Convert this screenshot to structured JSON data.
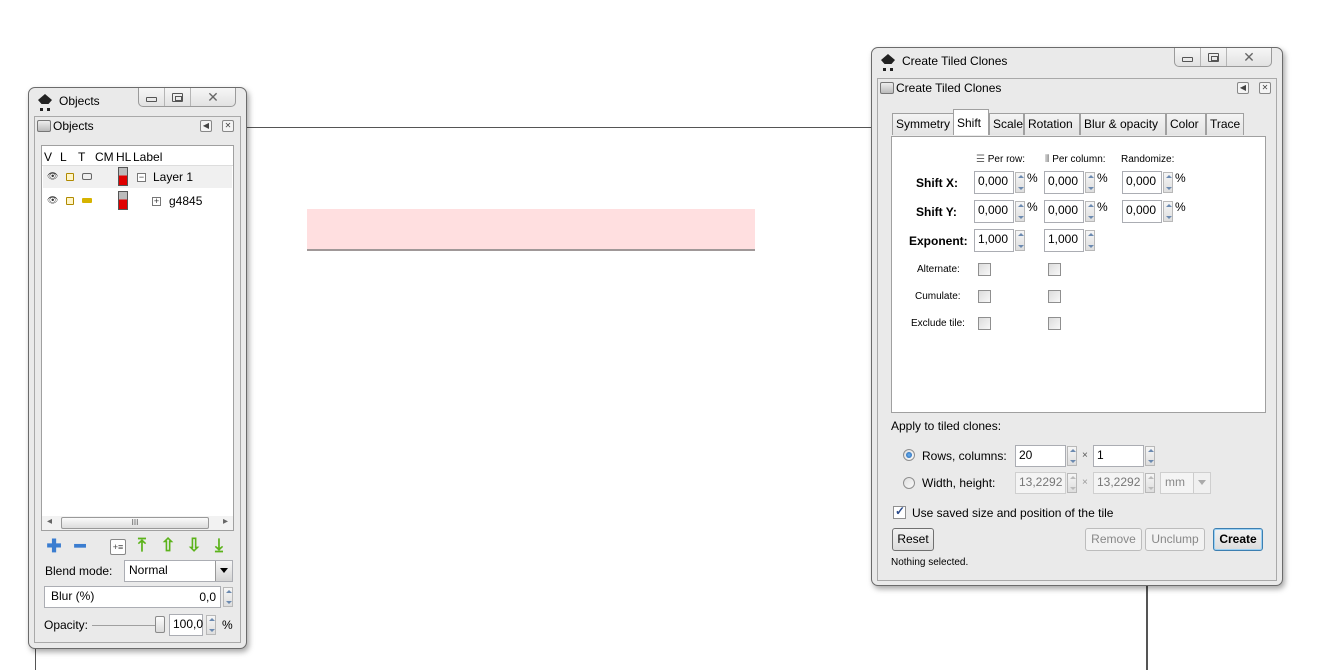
{
  "canvas": {
    "selected_object_fill": "#ffdfe0"
  },
  "objects_window": {
    "title": "Objects",
    "dock_title": "Objects",
    "columns": [
      "V",
      "L",
      "T",
      "CM",
      "HL",
      "Label"
    ],
    "rows": [
      {
        "label": "Layer 1",
        "expander": "−",
        "type": "layer",
        "selected": true
      },
      {
        "label": "g4845",
        "expander": "+",
        "type": "group",
        "selected": false
      }
    ],
    "blend_mode_label": "Blend mode:",
    "blend_mode_value": "Normal",
    "blur_label": "Blur (%)",
    "blur_value": "0,0",
    "opacity_label": "Opacity:",
    "opacity_value": "100,0",
    "opacity_percent": 100,
    "opacity_unit": "%",
    "scroll_thumb_glyph": "III"
  },
  "tiled_window": {
    "title": "Create Tiled Clones",
    "dock_title": "Create Tiled Clones",
    "tabs": [
      {
        "label": "Symmetry",
        "active": false
      },
      {
        "label": "Shift",
        "active": true
      },
      {
        "label": "Scale",
        "active": false
      },
      {
        "label": "Rotation",
        "active": false
      },
      {
        "label": "Blur & opacity",
        "active": false
      },
      {
        "label": "Color",
        "active": false
      },
      {
        "label": "Trace",
        "active": false
      }
    ],
    "shift": {
      "col_headers": {
        "per_row": "Per row:",
        "per_column": "Per column:",
        "randomize": "Randomize:"
      },
      "shift_x": {
        "label": "Shift X:",
        "per_row": "0,000",
        "per_column": "0,000",
        "randomize": "0,000",
        "unit": "%"
      },
      "shift_y": {
        "label": "Shift Y:",
        "per_row": "0,000",
        "per_column": "0,000",
        "randomize": "0,000",
        "unit": "%"
      },
      "exponent": {
        "label": "Exponent:",
        "per_row": "1,000",
        "per_column": "1,000"
      },
      "alternate": {
        "label": "Alternate:",
        "per_row": false,
        "per_column": false
      },
      "cumulate": {
        "label": "Cumulate:",
        "per_row": false,
        "per_column": false
      },
      "exclude_tile": {
        "label": "Exclude tile:",
        "per_row": false,
        "per_column": false
      }
    },
    "apply_label": "Apply to tiled clones:",
    "rows_columns": {
      "label": "Rows, columns:",
      "rows": "20",
      "columns": "1",
      "selected": true,
      "times": "×"
    },
    "width_height": {
      "label": "Width, height:",
      "width": "13,2292",
      "height": "13,2292",
      "unit": "mm",
      "selected": false,
      "times": "×"
    },
    "use_saved": {
      "label": "Use saved size and position of the tile",
      "checked": true
    },
    "buttons": {
      "reset": "Reset",
      "remove": "Remove",
      "unclump": "Unclump",
      "create": "Create"
    },
    "status": "Nothing selected."
  }
}
